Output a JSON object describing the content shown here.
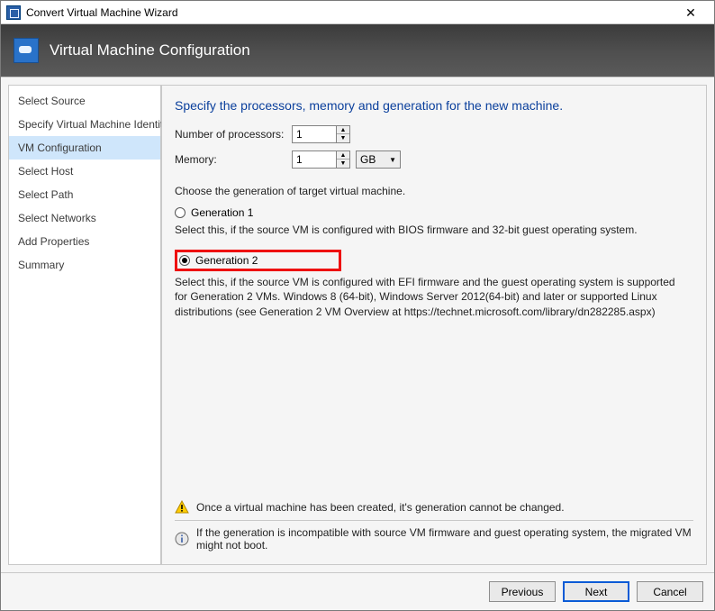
{
  "window": {
    "title": "Convert Virtual Machine Wizard"
  },
  "banner": {
    "title": "Virtual Machine Configuration"
  },
  "sidebar": {
    "items": [
      {
        "label": "Select Source"
      },
      {
        "label": "Specify Virtual Machine Identity"
      },
      {
        "label": "VM Configuration"
      },
      {
        "label": "Select Host"
      },
      {
        "label": "Select Path"
      },
      {
        "label": "Select Networks"
      },
      {
        "label": "Add Properties"
      },
      {
        "label": "Summary"
      }
    ],
    "active_index": 2
  },
  "content": {
    "heading": "Specify the processors, memory and generation for the new machine.",
    "procs_label": "Number of processors:",
    "procs_value": "1",
    "mem_label": "Memory:",
    "mem_value": "1",
    "mem_unit": "GB",
    "gen_text": "Choose the generation of target virtual machine.",
    "gen1": {
      "label": "Generation 1",
      "desc": "Select this, if the source VM is configured with BIOS firmware and 32-bit guest operating system."
    },
    "gen2": {
      "label": "Generation 2",
      "desc": "Select this, if the source VM is configured with EFI firmware and the guest operating system is supported for Generation 2 VMs. Windows 8 (64-bit), Windows Server 2012(64-bit) and later or supported Linux distributions (see Generation 2 VM Overview at https://technet.microsoft.com/library/dn282285.aspx)"
    },
    "selected_generation": "gen2",
    "warning": "Once a virtual machine has been created, it's generation cannot be changed.",
    "info": "If the generation is incompatible with source VM firmware and guest operating system, the migrated VM might not boot."
  },
  "footer": {
    "previous": "Previous",
    "next": "Next",
    "cancel": "Cancel"
  }
}
